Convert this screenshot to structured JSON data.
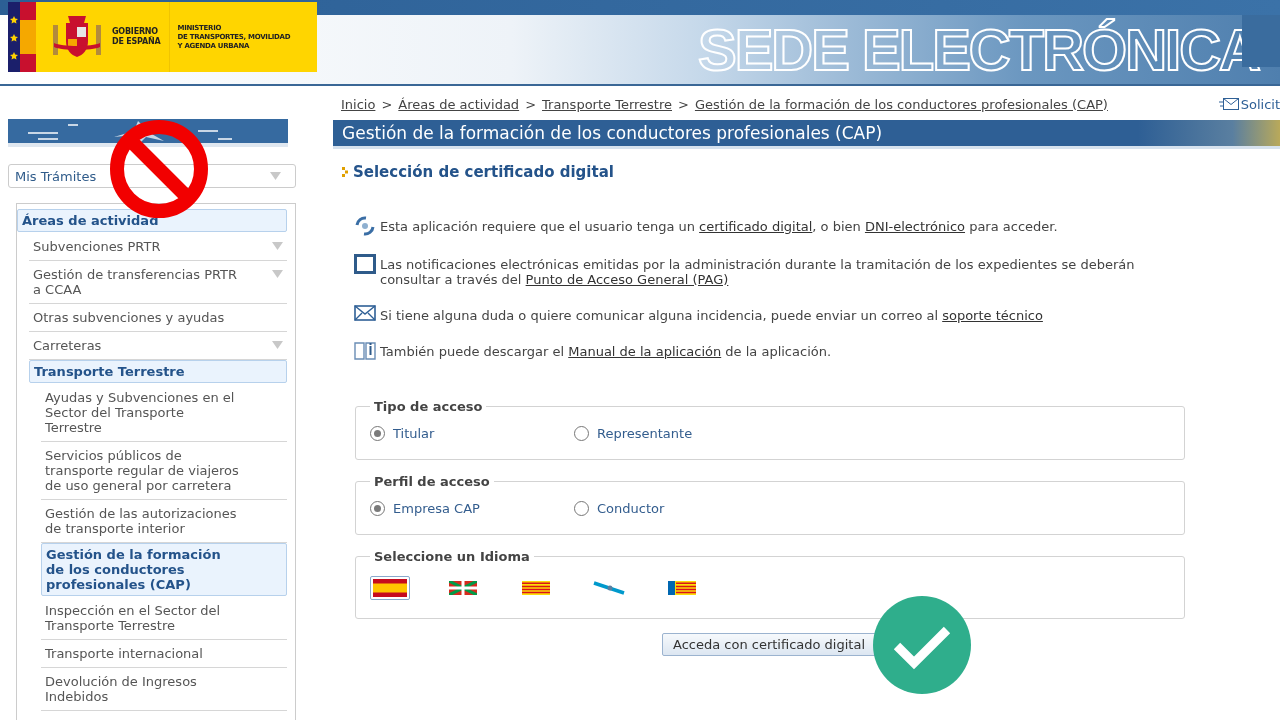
{
  "header": {
    "government": [
      "GOBIERNO",
      "DE ESPAÑA"
    ],
    "ministry": [
      "MINISTERIO",
      "DE TRANSPORTES, MOVILIDAD",
      "Y AGENDA URBANA"
    ],
    "site_title": "SEDE ELECTRÓNICA"
  },
  "breadcrumb": [
    {
      "label": "Inicio"
    },
    {
      "label": "Áreas de actividad"
    },
    {
      "label": "Transporte Terrestre"
    },
    {
      "label": "Gestión de la formación de los conductores profesionales (CAP)"
    }
  ],
  "breadcrumb_separator": ">",
  "contact_link": "Solicit",
  "sidebar": {
    "dropdown": "Mis Trámites",
    "menu": [
      {
        "label": "Áreas de actividad",
        "selected": true,
        "expandable": false,
        "children": [
          {
            "label": "Subvenciones PRTR",
            "selected": false,
            "expandable": true
          },
          {
            "label": "Gestión de transferencias PRTR a CCAA",
            "selected": false,
            "expandable": true
          },
          {
            "label": "Otras subvenciones y ayudas",
            "selected": false,
            "expandable": false
          },
          {
            "label": "Carreteras",
            "selected": false,
            "expandable": true
          },
          {
            "label": "Transporte Terrestre",
            "selected": true,
            "expandable": false,
            "children": [
              {
                "label": "Ayudas y Subvenciones en el Sector del Transporte Terrestre",
                "selected": false,
                "expandable": false
              },
              {
                "label": "Servicios públicos de transporte regular de viajeros de uso general por carretera",
                "selected": false,
                "expandable": false
              },
              {
                "label": "Gestión de las autorizaciones de transporte interior",
                "selected": false,
                "expandable": false
              },
              {
                "label": "Gestión de la formación de los conductores profesionales (CAP)",
                "selected": true,
                "expandable": false
              },
              {
                "label": "Inspección en el Sector del Transporte Terrestre",
                "selected": false,
                "expandable": false
              },
              {
                "label": "Transporte internacional",
                "selected": false,
                "expandable": false
              },
              {
                "label": "Devolución de Ingresos Indebidos",
                "selected": false,
                "expandable": false
              }
            ]
          }
        ]
      }
    ]
  },
  "page_title": "Gestión de la formación de los conductores profesionales (CAP)",
  "section_heading": "Selección de certificado digital",
  "notices": [
    {
      "kind": "certificate",
      "parts": [
        {
          "text": "Esta aplicación requiere que el usuario tenga un ",
          "link": false
        },
        {
          "text": "certificado digital",
          "link": true
        },
        {
          "text": ", o bien ",
          "link": false
        },
        {
          "text": "DNI-electrónico",
          "link": true
        },
        {
          "text": " para acceder.",
          "link": false
        }
      ]
    },
    {
      "kind": "notification",
      "parts": [
        {
          "text": "Las notificaciones electrónicas emitidas por la administración durante la tramitación de los expedientes se deberán consultar a través del ",
          "link": false
        },
        {
          "text": "Punto de Acceso General (PAG)",
          "link": true
        }
      ]
    },
    {
      "kind": "mail",
      "parts": [
        {
          "text": "Si tiene alguna duda o quiere comunicar alguna incidencia, puede enviar un correo al ",
          "link": false
        },
        {
          "text": "soporte técnico",
          "link": true
        }
      ]
    },
    {
      "kind": "manual",
      "parts": [
        {
          "text": "También puede descargar el ",
          "link": false
        },
        {
          "text": "Manual de la aplicación",
          "link": true
        },
        {
          "text": " de la aplicación.",
          "link": false
        }
      ]
    }
  ],
  "access_groups": [
    {
      "legend": "Tipo de acceso",
      "options": [
        {
          "label": "Titular",
          "selected": true
        },
        {
          "label": "Representante",
          "selected": false
        }
      ]
    },
    {
      "legend": "Perfil de acceso",
      "options": [
        {
          "label": "Empresa CAP",
          "selected": true
        },
        {
          "label": "Conductor",
          "selected": false
        }
      ]
    }
  ],
  "languages": {
    "legend": "Seleccione un Idioma",
    "flags": [
      {
        "kind": "es",
        "selected": true
      },
      {
        "kind": "eu",
        "selected": false
      },
      {
        "kind": "ca",
        "selected": false
      },
      {
        "kind": "gl",
        "selected": false
      },
      {
        "kind": "va",
        "selected": false
      }
    ]
  },
  "submit_button": "Acceda con certificado digital"
}
